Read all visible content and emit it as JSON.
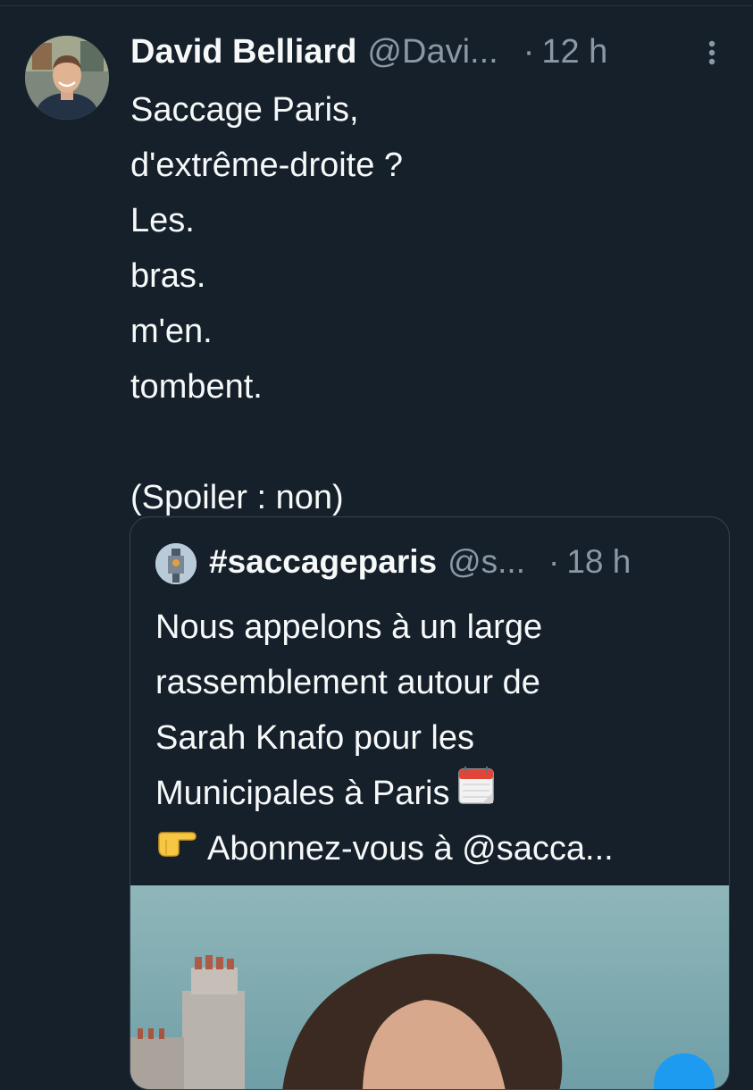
{
  "tweet": {
    "author_name": "David Belliard",
    "author_handle": "@Davi...",
    "time": "12 h",
    "separator": "·",
    "text_lines": [
      "Saccage Paris,",
      "d'extrême-droite ?",
      "Les.",
      "bras.",
      "m'en.",
      "tombent.",
      "",
      "(Spoiler : non)"
    ]
  },
  "quoted_tweet": {
    "author_name": "#saccageparis",
    "author_handle": "@s...",
    "time": "18 h",
    "separator": "·",
    "text_lines": [
      "Nous appelons à un large",
      "rassemblement autour de",
      "Sarah Knafo pour les",
      "Municipales à Paris",
      "Abonnez-vous à @sacca..."
    ],
    "line4_emoji": "calendar-icon",
    "line5_emoji": "pointing-right-icon"
  },
  "colors": {
    "background": "#15202b",
    "text_primary": "#f7f9f9",
    "text_secondary": "#8b98a5",
    "border": "#38444d"
  }
}
